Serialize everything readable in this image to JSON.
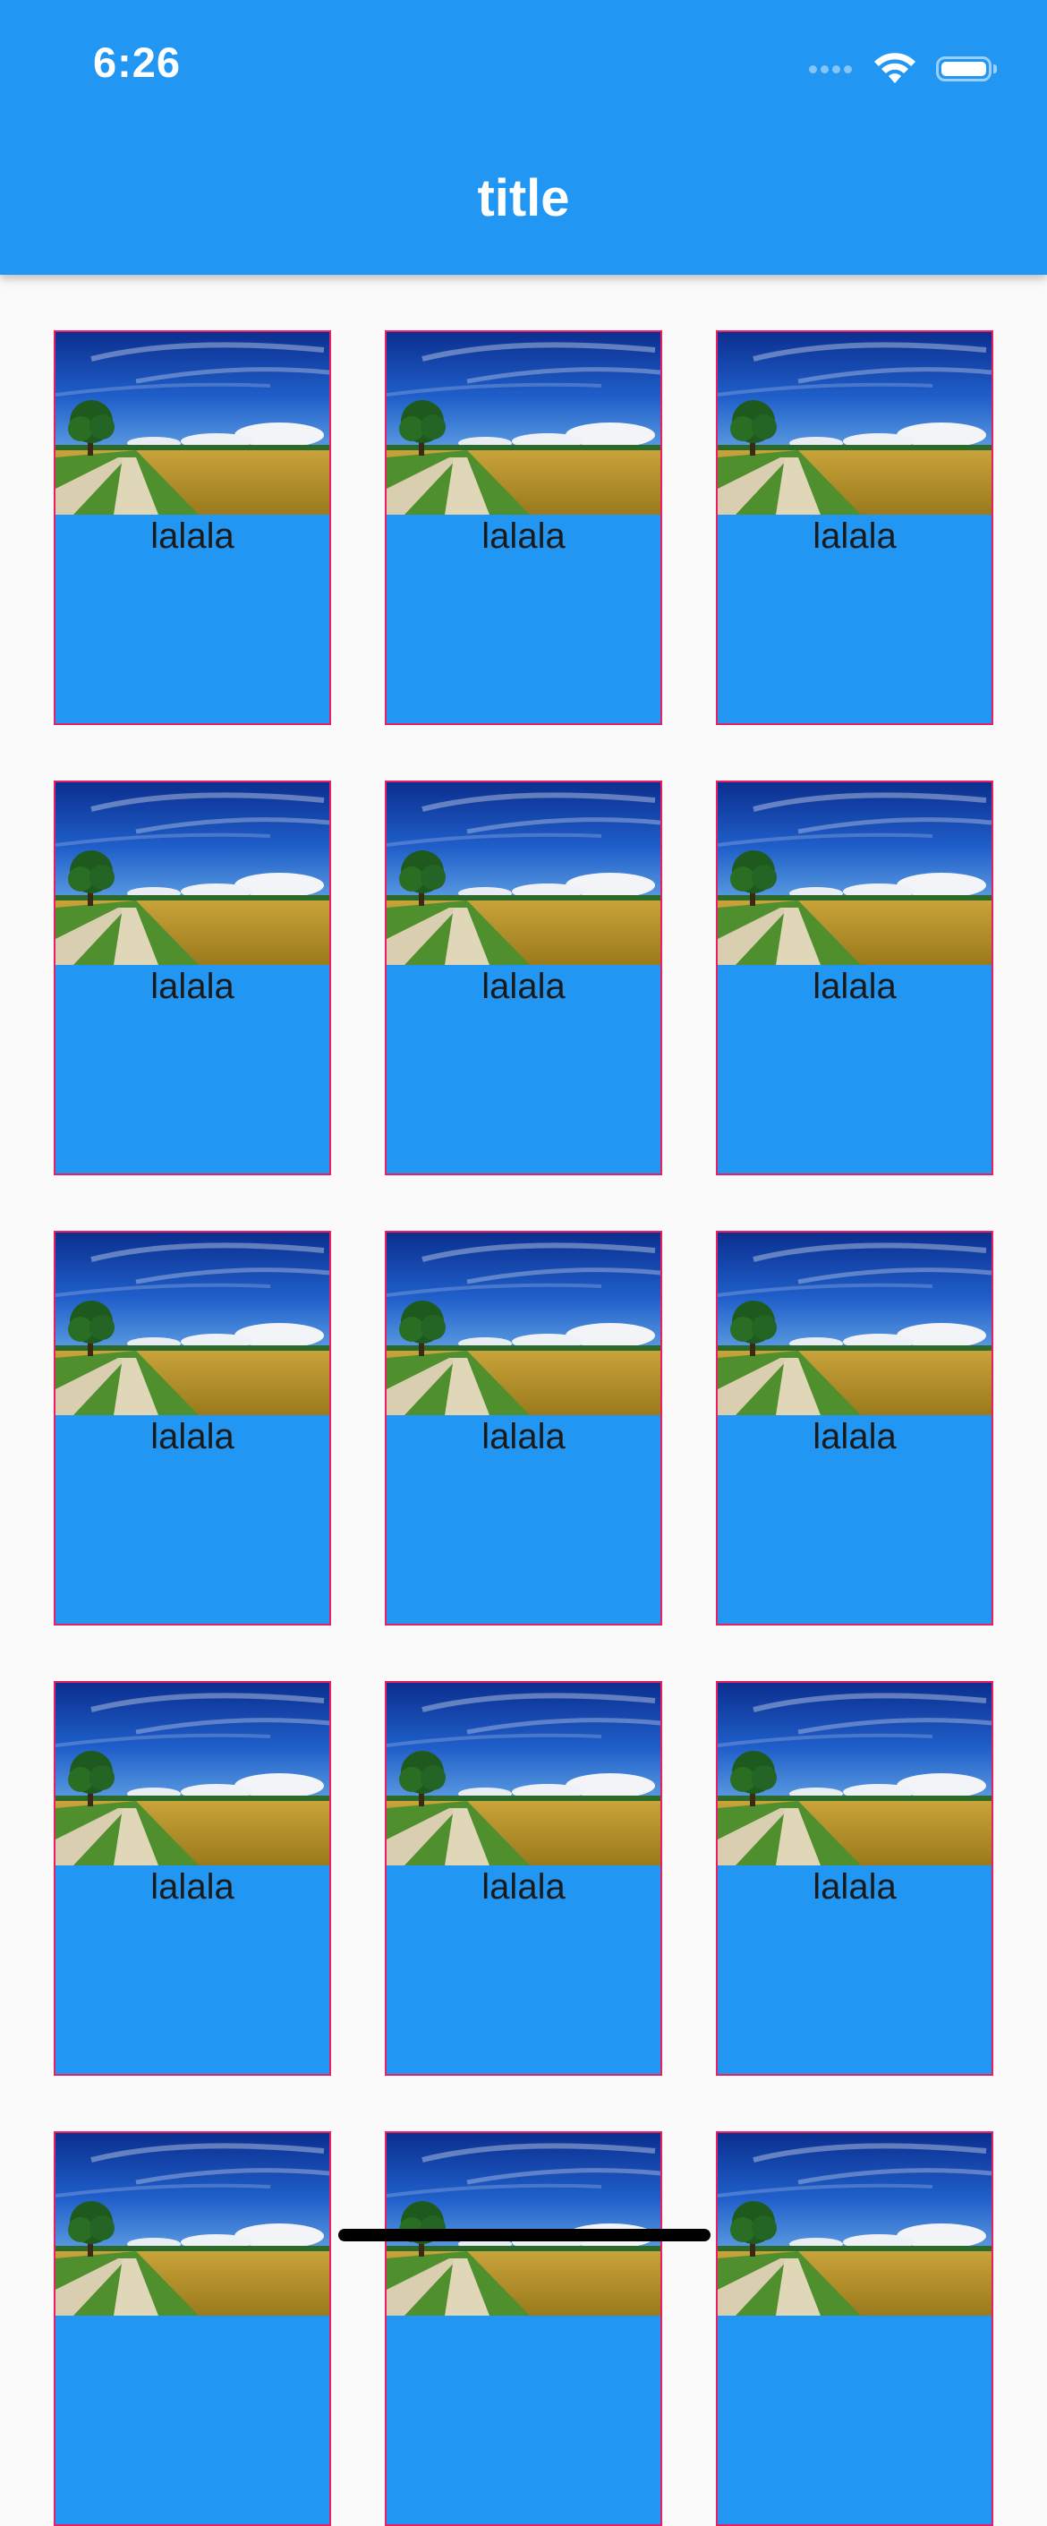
{
  "status_bar": {
    "time": "6:26"
  },
  "app_bar": {
    "title": "title",
    "background": "#2196f3"
  },
  "grid": {
    "card_background": "#2196f3",
    "card_border": "#e91e63",
    "items": [
      {
        "label": "lalala",
        "image": "landscape-field-tree"
      },
      {
        "label": "lalala",
        "image": "landscape-field-tree"
      },
      {
        "label": "lalala",
        "image": "landscape-field-tree"
      },
      {
        "label": "lalala",
        "image": "landscape-field-tree"
      },
      {
        "label": "lalala",
        "image": "landscape-field-tree"
      },
      {
        "label": "lalala",
        "image": "landscape-field-tree"
      },
      {
        "label": "lalala",
        "image": "landscape-field-tree"
      },
      {
        "label": "lalala",
        "image": "landscape-field-tree"
      },
      {
        "label": "lalala",
        "image": "landscape-field-tree"
      },
      {
        "label": "lalala",
        "image": "landscape-field-tree"
      },
      {
        "label": "lalala",
        "image": "landscape-field-tree"
      },
      {
        "label": "lalala",
        "image": "landscape-field-tree"
      },
      {
        "label": "",
        "image": "landscape-field-tree"
      },
      {
        "label": "",
        "image": "landscape-field-tree"
      },
      {
        "label": "",
        "image": "landscape-field-tree"
      }
    ]
  }
}
